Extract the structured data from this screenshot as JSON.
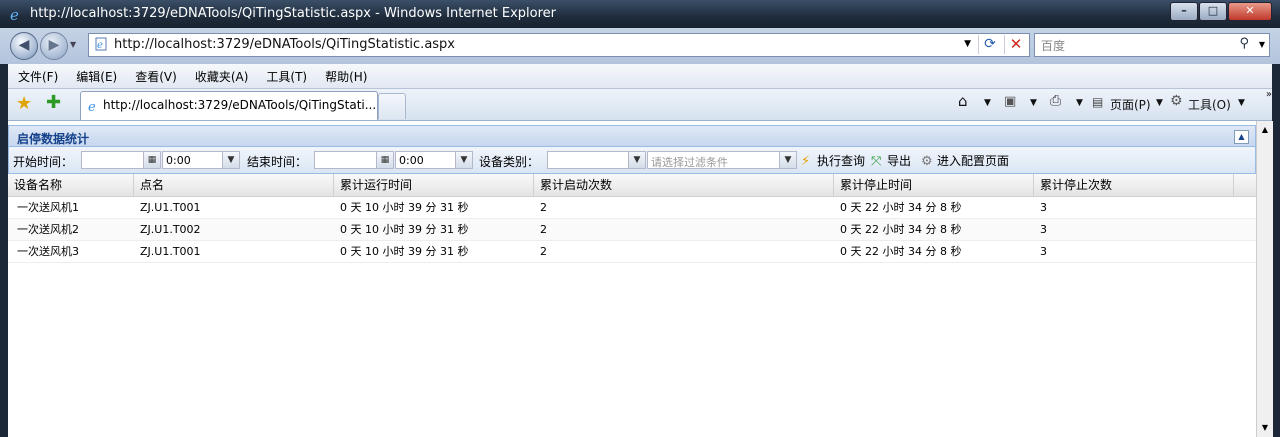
{
  "window": {
    "title": "http://localhost:3729/eDNATools/QiTingStatistic.aspx - Windows Internet Explorer"
  },
  "address": {
    "url": "http://localhost:3729/eDNATools/QiTingStatistic.aspx"
  },
  "search": {
    "placeholder": "百度"
  },
  "menu": [
    "文件(F)",
    "编辑(E)",
    "查看(V)",
    "收藏夹(A)",
    "工具(T)",
    "帮助(H)"
  ],
  "tab": {
    "label": "http://localhost:3729/eDNATools/QiTingStati..."
  },
  "commandbar": {
    "page_label": "页面(P)",
    "tools_label": "工具(O)"
  },
  "panel": {
    "title": "启停数据统计"
  },
  "toolbar": {
    "start_label": "开始时间：",
    "start_date": "",
    "start_time": "0:00",
    "end_label": "结束时间：",
    "end_date": "",
    "end_time": "0:00",
    "category_label": "设备类别：",
    "category_value": "",
    "filter_placeholder": "请选择过滤条件",
    "execute_label": "执行查询",
    "export_label": "导出",
    "config_label": "进入配置页面"
  },
  "grid": {
    "columns": [
      "设备名称",
      "点名",
      "累计运行时间",
      "累计启动次数",
      "累计停止时间",
      "累计停止次数"
    ],
    "rows": [
      [
        "一次送风机1",
        "ZJ.U1.T001",
        "0 天  10 小时  39 分  31 秒",
        "2",
        "0 天  22 小时  34 分  8 秒",
        "3"
      ],
      [
        "一次送风机2",
        "ZJ.U1.T002",
        "0 天  10 小时  39 分  31 秒",
        "2",
        "0 天  22 小时  34 分  8 秒",
        "3"
      ],
      [
        "一次送风机3",
        "ZJ.U1.T001",
        "0 天  10 小时  39 分  31 秒",
        "2",
        "0 天  22 小时  34 分  8 秒",
        "3"
      ]
    ]
  }
}
